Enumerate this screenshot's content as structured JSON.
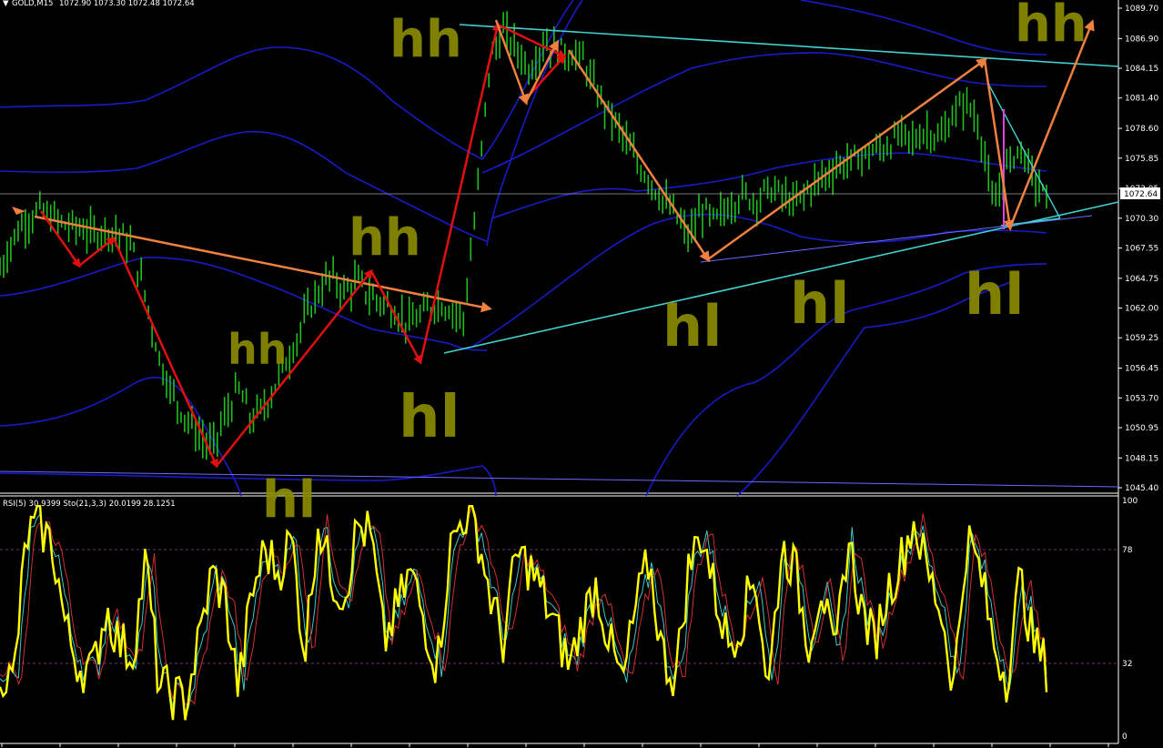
{
  "window": {
    "symbol_header": "GOLD,M15",
    "ohlc_header": "1072.90 1073.30 1072.48 1072.64",
    "current_price_label": "1072.64"
  },
  "price_axis": {
    "ticks": [
      "1089.70",
      "1086.90",
      "1084.15",
      "1081.40",
      "1078.60",
      "1075.85",
      "1073.05",
      "1070.30",
      "1067.55",
      "1064.75",
      "1062.00",
      "1059.25",
      "1056.45",
      "1053.70",
      "1050.95",
      "1048.15",
      "1045.40"
    ]
  },
  "indicator": {
    "header": "RSI(5) 30.9399  Sto(21,3,3) 20.0199 28.1251",
    "levels": [
      "100",
      "78",
      "32",
      "0"
    ]
  },
  "annotations": {
    "hh": "hh",
    "hl": "hl"
  },
  "colors": {
    "background": "#000000",
    "candles": "#20c020",
    "bollinger": "#1a1ac8",
    "trendline_cyan": "#40d0d0",
    "arrow_red": "#e01010",
    "arrow_orange": "#f08040",
    "rsi": "#ffff00",
    "handwriting": "#8a8a00"
  },
  "chart_data": [
    {
      "type": "line",
      "title": "GOLD,M15",
      "ylim": [
        1045.4,
        1089.7
      ],
      "y_ticks": [
        1089.7,
        1086.9,
        1084.15,
        1081.4,
        1078.6,
        1075.85,
        1073.05,
        1070.3,
        1067.55,
        1064.75,
        1062.0,
        1059.25,
        1056.45,
        1053.7,
        1050.95,
        1048.15,
        1045.4
      ],
      "last_price": 1072.64,
      "series": [
        {
          "values": [
            1065.5,
            1068.5,
            1070.2,
            1071.0,
            1070.3,
            1069.6,
            1069.4,
            1068.8,
            1069.3,
            1068.9,
            1067.5,
            1063.0,
            1057.5,
            1054.0,
            1052.0,
            1050.3,
            1049.0,
            1052.0,
            1054.5,
            1051.5,
            1053.0,
            1055.5,
            1058.0,
            1061.0,
            1063.5,
            1065.0,
            1063.5,
            1064.5,
            1063.0,
            1062.5,
            1061.5,
            1060.5,
            1061.5,
            1062.5,
            1062.0,
            1061.0,
            1072.0,
            1085.0,
            1087.5,
            1086.0,
            1084.0,
            1086.5,
            1086.0,
            1085.5,
            1085.0,
            1082.0,
            1080.0,
            1078.0,
            1075.5,
            1074.0,
            1072.0,
            1070.5,
            1068.5,
            1071.0,
            1070.0,
            1071.5,
            1072.5,
            1072.0,
            1073.0,
            1072.5,
            1071.5,
            1073.0,
            1074.0,
            1075.0,
            1075.5,
            1076.0,
            1076.5,
            1077.0,
            1078.0,
            1077.5,
            1078.5,
            1077.5,
            1080.0,
            1081.0,
            1078.5,
            1071.0,
            1075.0,
            1077.0,
            1074.0,
            1072.0
          ]
        }
      ]
    },
    {
      "type": "line",
      "title": "RSI(5) 30.9399  Sto(21,3,3) 20.0199 28.1251",
      "ylim": [
        0,
        100
      ],
      "y_ticks": [
        100,
        78,
        32,
        0
      ],
      "series": [
        {
          "name": "RSI(5)",
          "values": [
            30,
            22,
            85,
            90,
            80,
            45,
            30,
            28,
            55,
            40,
            35,
            75,
            22,
            18,
            15,
            40,
            70,
            58,
            20,
            60,
            80,
            70,
            85,
            35,
            92,
            68,
            60,
            90,
            85,
            40,
            55,
            70,
            50,
            30,
            80,
            95,
            88,
            60,
            40,
            78,
            72,
            60,
            45,
            30,
            50,
            65,
            40,
            22,
            55,
            75,
            35,
            25,
            72,
            88,
            60,
            40,
            50,
            70,
            20,
            80,
            72,
            40,
            65,
            30,
            85,
            55,
            40,
            62,
            75,
            92,
            70,
            55,
            22,
            85,
            70,
            40,
            25,
            68,
            40,
            30
          ]
        }
      ]
    }
  ]
}
